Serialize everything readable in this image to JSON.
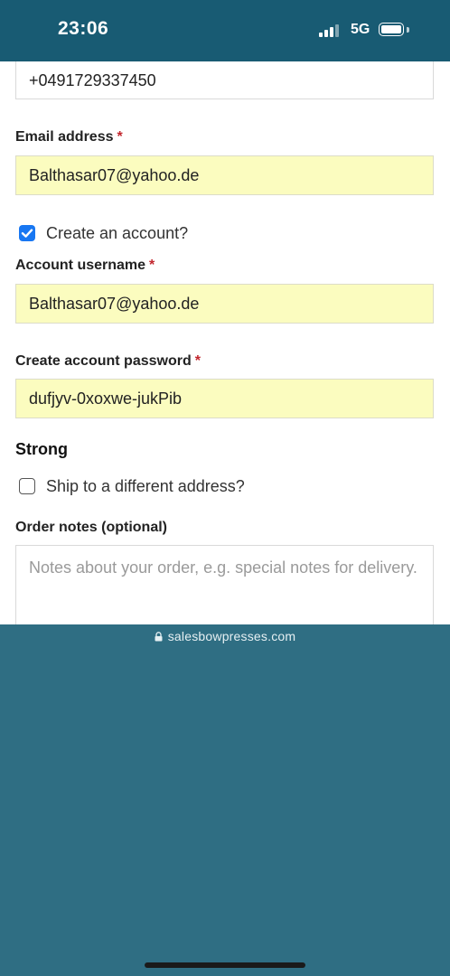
{
  "status_bar": {
    "time": "23:06",
    "network": "5G"
  },
  "form": {
    "phone_value": "+0491729337450",
    "email_label": "Email address",
    "email_value": "Balthasar07@yahoo.de",
    "create_account_label": "Create an account?",
    "create_account_checked": true,
    "username_label": "Account username",
    "username_value": "Balthasar07@yahoo.de",
    "password_label": "Create account password",
    "password_value": "dufjyv-0xoxwe-jukPib",
    "password_strength": "Strong",
    "ship_different_label": "Ship to a different address?",
    "ship_different_checked": false,
    "order_notes_label": "Order notes (optional)",
    "order_notes_placeholder": "Notes about your order, e.g. special notes for delivery.",
    "required_marker": "*"
  },
  "browser": {
    "url": "salesbowpresses.com"
  },
  "colors": {
    "header": "#185b73",
    "autofill": "#fbfcbf",
    "checkbox": "#1877f2",
    "required": "#c2262d"
  }
}
